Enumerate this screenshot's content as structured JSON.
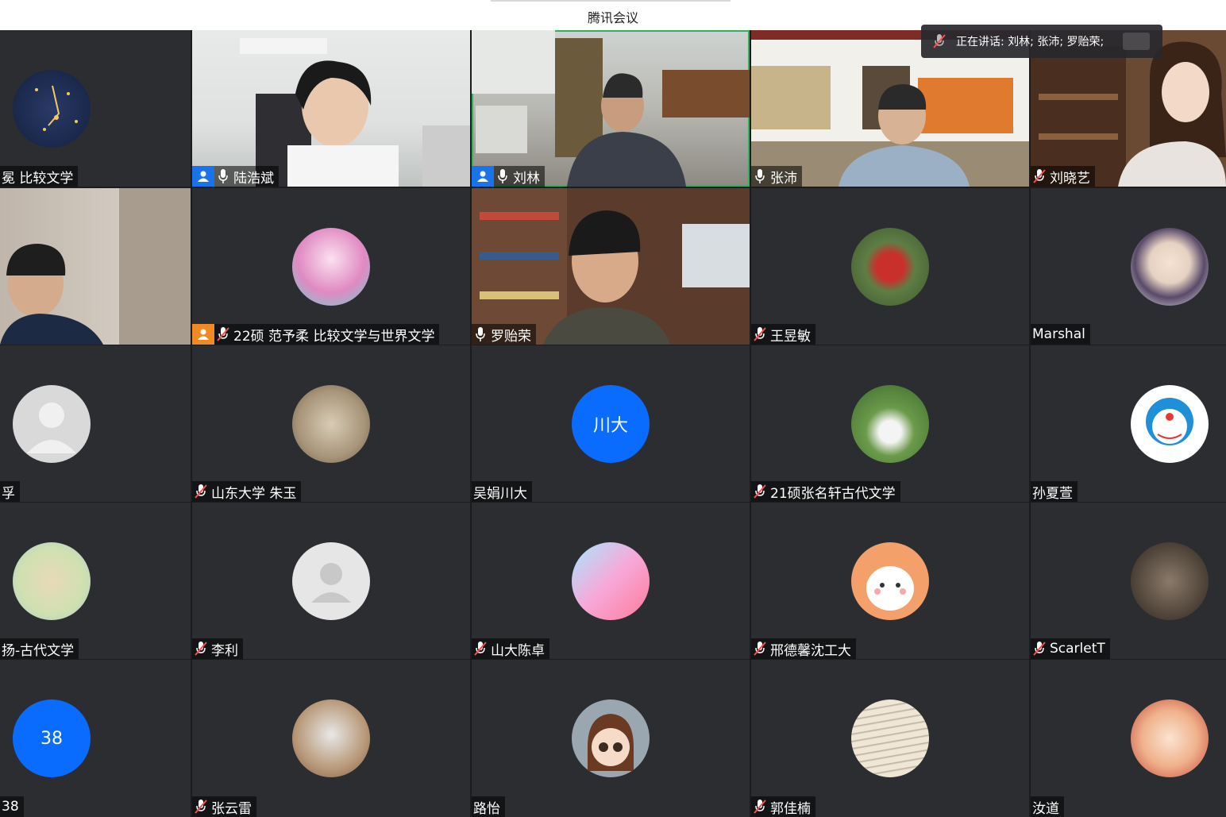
{
  "window": {
    "title": "腾讯会议"
  },
  "speaking_banner": {
    "text": "正在讲话: 刘林; 张沛; 罗贻荣;"
  },
  "tiles": [
    {
      "name": "冕 比较文学"
    },
    {
      "name": "陆浩斌"
    },
    {
      "name": "刘林"
    },
    {
      "name": "张沛"
    },
    {
      "name": "刘晓艺"
    },
    {
      "name": ""
    },
    {
      "name": "22硕 范予柔 比较文学与世界文学"
    },
    {
      "name": "罗贻荣"
    },
    {
      "name": "王昱敏"
    },
    {
      "name": "Marshal"
    },
    {
      "name": "孚"
    },
    {
      "name": "山东大学 朱玉"
    },
    {
      "name": "吴娟川大",
      "avatar_text": "川大"
    },
    {
      "name": "21硕张名轩古代文学"
    },
    {
      "name": "孙夏萱"
    },
    {
      "name": "扬-古代文学"
    },
    {
      "name": "李利"
    },
    {
      "name": "山大陈卓"
    },
    {
      "name": "邢德馨沈工大"
    },
    {
      "name": "ScarletT"
    },
    {
      "name": "38",
      "avatar_text": "38"
    },
    {
      "name": "张云雷"
    },
    {
      "name": "路怡"
    },
    {
      "name": "郭佳楠"
    },
    {
      "name": "汝道"
    }
  ]
}
